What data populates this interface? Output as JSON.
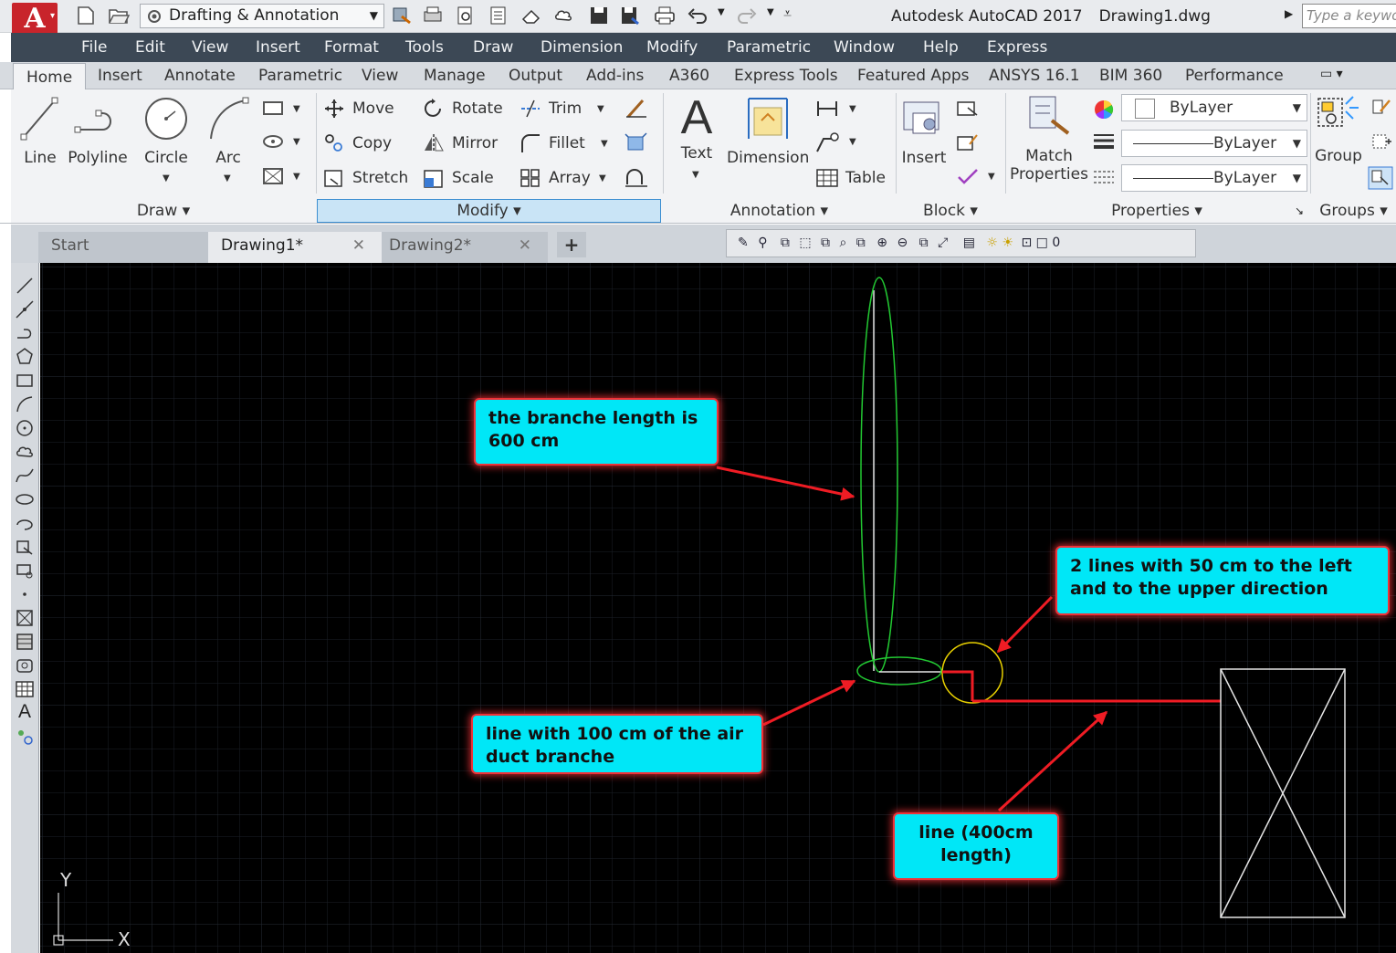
{
  "app": {
    "logo_letter": "A",
    "workspace": "Drafting & Annotation",
    "title": "Autodesk AutoCAD 2017",
    "document_name": "Drawing1.dwg",
    "search_placeholder": "Type a keywo"
  },
  "menu": [
    "File",
    "Edit",
    "View",
    "Insert",
    "Format",
    "Tools",
    "Draw",
    "Dimension",
    "Modify",
    "Parametric",
    "Window",
    "Help",
    "Express"
  ],
  "ribbon_tabs": [
    "Home",
    "Insert",
    "Annotate",
    "Parametric",
    "View",
    "Manage",
    "Output",
    "Add-ins",
    "A360",
    "Express Tools",
    "Featured Apps",
    "ANSYS 16.1",
    "BIM 360",
    "Performance"
  ],
  "active_ribbon_tab": "Home",
  "draw_panel": {
    "title": "Draw",
    "tools": [
      "Line",
      "Polyline",
      "Circle",
      "Arc"
    ]
  },
  "modify_panel": {
    "title": "Modify",
    "tools": [
      "Move",
      "Rotate",
      "Trim",
      "Copy",
      "Mirror",
      "Fillet",
      "Stretch",
      "Scale",
      "Array"
    ]
  },
  "annotation_panel": {
    "title": "Annotation",
    "tools": [
      "Text",
      "Dimension",
      "Table"
    ]
  },
  "block_panel": {
    "title": "Block",
    "tools": [
      "Insert"
    ]
  },
  "properties_panel": {
    "title": "Properties",
    "match_label_line1": "Match",
    "match_label_line2": "Properties",
    "color": "ByLayer",
    "linetype": "ByLayer",
    "lineweight": "ByLayer"
  },
  "groups_panel": {
    "title": "Groups",
    "tools": [
      "Group"
    ]
  },
  "document_tabs": {
    "start": "Start",
    "tabs": [
      "Drawing1*",
      "Drawing2*"
    ],
    "active": "Drawing1*"
  },
  "layer_value": "0",
  "callouts": {
    "branch_length": "the branche length is\n600 cm",
    "two_lines": "2 lines with 50 cm  to the left\nand to the upper direction",
    "line_100": "line with 100 cm of the air\nduct branche",
    "line_400": "line (400cm\nlength)"
  },
  "ucs": {
    "x": "X",
    "y": "Y"
  },
  "colors": {
    "callout_fill": "#00e7f7",
    "callout_border": "#ef3137",
    "arrow": "#ef1c24",
    "ellipse": "#22c832",
    "circle": "#e8d000",
    "menubar": "#3c4855"
  }
}
